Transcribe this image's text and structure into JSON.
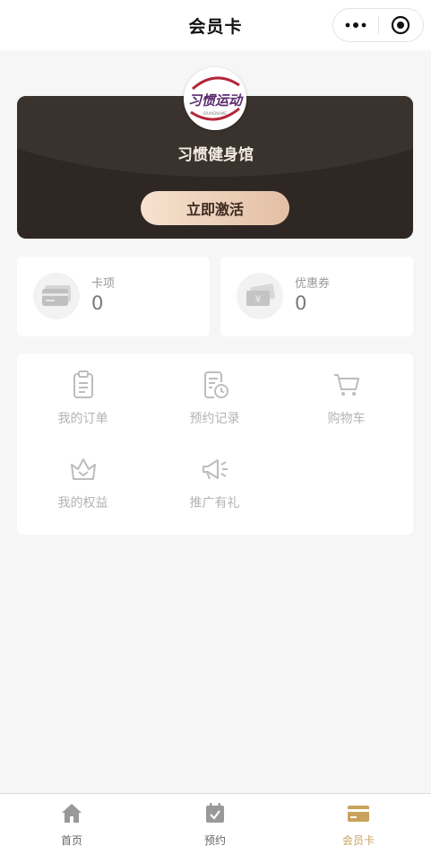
{
  "header": {
    "title": "会员卡"
  },
  "card": {
    "logo_text": "习惯运动",
    "logo_sub": "BRANDNAME",
    "gym_name": "习惯健身馆",
    "activate_label": "立即激活"
  },
  "stats": [
    {
      "label": "卡项",
      "value": "0",
      "icon": "card-icon"
    },
    {
      "label": "优惠券",
      "value": "0",
      "icon": "coupon-icon"
    }
  ],
  "menu": [
    {
      "label": "我的订单",
      "icon": "clipboard-icon"
    },
    {
      "label": "预约记录",
      "icon": "booking-record-icon"
    },
    {
      "label": "购物车",
      "icon": "cart-icon"
    },
    {
      "label": "我的权益",
      "icon": "crown-icon"
    },
    {
      "label": "推广有礼",
      "icon": "megaphone-icon"
    }
  ],
  "tabbar": [
    {
      "label": "首页",
      "icon": "home-icon",
      "active": false
    },
    {
      "label": "预约",
      "icon": "calendar-check-icon",
      "active": false
    },
    {
      "label": "会员卡",
      "icon": "member-card-icon",
      "active": true
    }
  ],
  "colors": {
    "accent": "#c9a25c",
    "card_bg": "#2e2724",
    "button_gradient_start": "#f6e2cf",
    "button_gradient_end": "#e3bfa4",
    "logo_red": "#b3263a",
    "logo_purple": "#5a2a6e"
  }
}
